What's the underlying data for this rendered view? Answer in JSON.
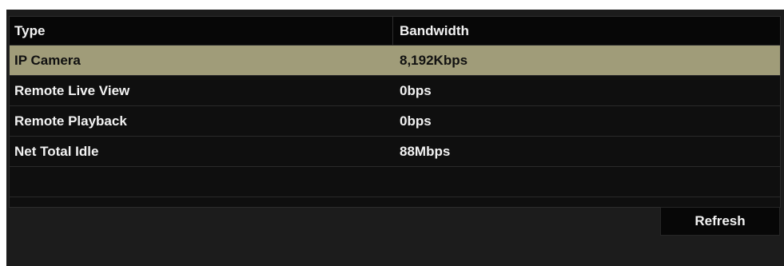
{
  "table": {
    "columns": [
      "Type",
      "Bandwidth"
    ],
    "rows": [
      {
        "type": "IP Camera",
        "bandwidth": "8,192Kbps",
        "selected": true
      },
      {
        "type": "Remote Live View",
        "bandwidth": "0bps",
        "selected": false
      },
      {
        "type": "Remote Playback",
        "bandwidth": "0bps",
        "selected": false
      },
      {
        "type": "Net Total Idle",
        "bandwidth": "88Mbps",
        "selected": false
      }
    ]
  },
  "buttons": {
    "refresh": "Refresh"
  },
  "colors": {
    "selected_row": "#a09c79",
    "panel_background": "#1c1c1c",
    "table_background": "#0f0f0f"
  }
}
